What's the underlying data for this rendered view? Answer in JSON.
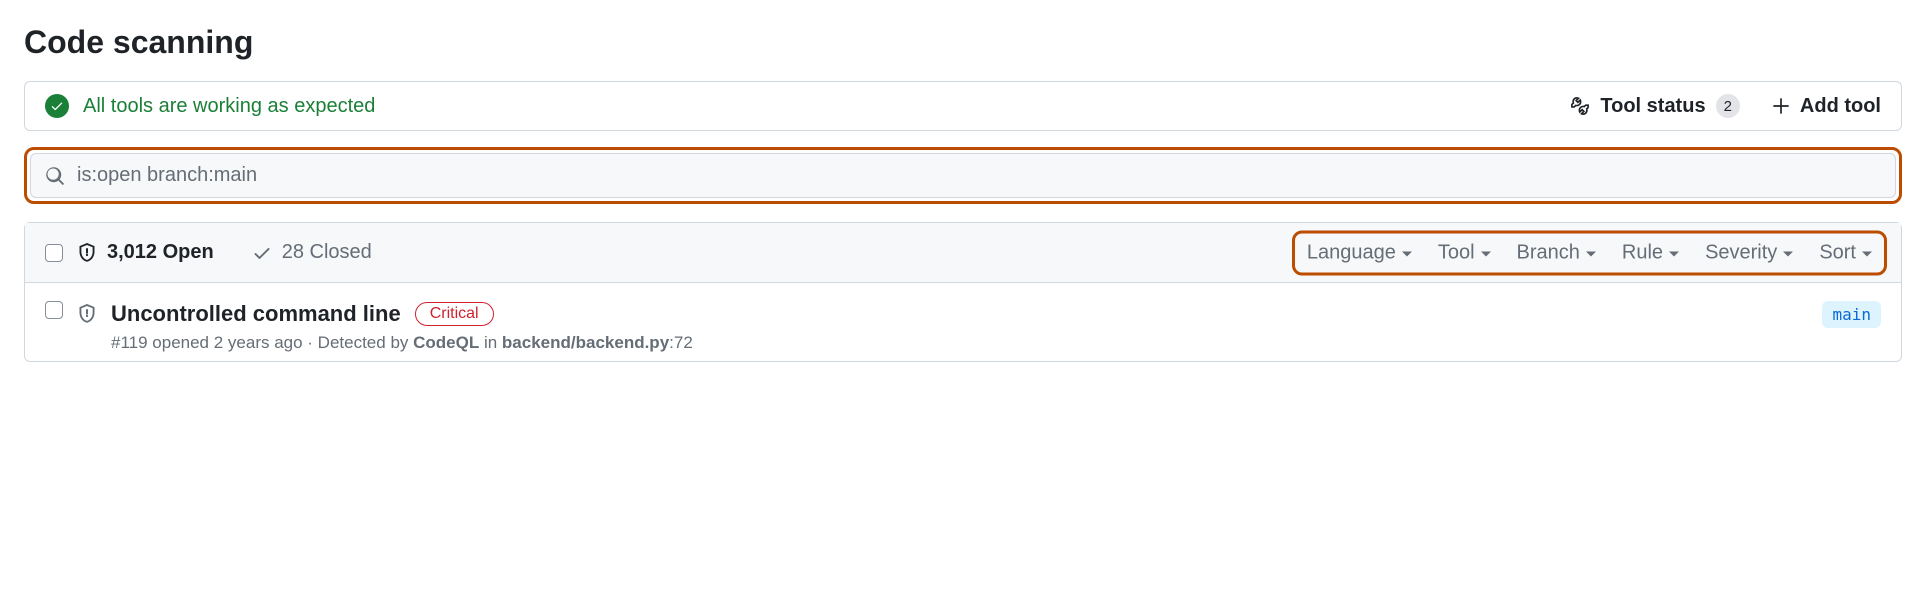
{
  "page": {
    "title": "Code scanning"
  },
  "status_bar": {
    "message": "All tools are working as expected",
    "tool_status_label": "Tool status",
    "tool_status_count": "2",
    "add_tool_label": "Add tool"
  },
  "search": {
    "value": "is:open branch:main"
  },
  "list_header": {
    "open_label": "3,012 Open",
    "closed_label": "28 Closed",
    "filters": [
      "Language",
      "Tool",
      "Branch",
      "Rule",
      "Severity",
      "Sort"
    ]
  },
  "alerts": [
    {
      "title": "Uncontrolled command line",
      "severity": "Critical",
      "meta_prefix": "#119 opened 2 years ago · Detected by ",
      "detector": "CodeQL",
      "meta_mid": " in ",
      "file": "backend/backend.py",
      "line_suffix": ":72",
      "branch": "main"
    }
  ]
}
